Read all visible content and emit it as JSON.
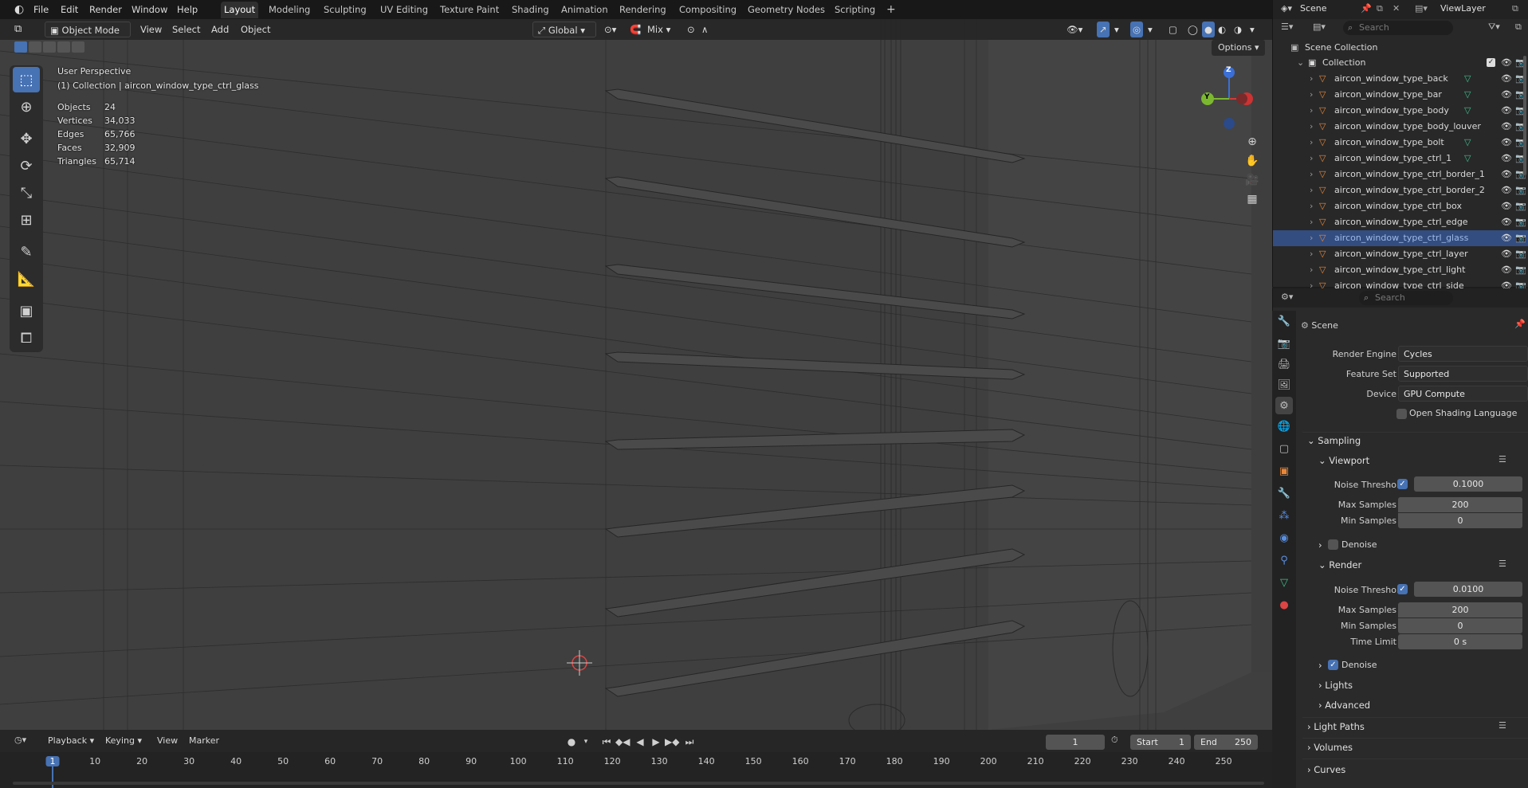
{
  "topbar": {
    "menus": [
      "File",
      "Edit",
      "Render",
      "Window",
      "Help"
    ],
    "workspaces": [
      "Layout",
      "Modeling",
      "Sculpting",
      "UV Editing",
      "Texture Paint",
      "Shading",
      "Animation",
      "Rendering",
      "Compositing",
      "Geometry Nodes",
      "Scripting"
    ],
    "active_workspace": "Layout",
    "scene": "Scene",
    "view_layer": "ViewLayer"
  },
  "viewport_header": {
    "mode": "Object Mode",
    "menus": [
      "View",
      "Select",
      "Add",
      "Object"
    ],
    "orientation": "Global",
    "snap_mode": "Mix",
    "options_label": "Options"
  },
  "overlay": {
    "perspective": "User Perspective",
    "collection_info": "(1) Collection | aircon_window_type_ctrl_glass",
    "stats": [
      {
        "label": "Objects",
        "value": "24"
      },
      {
        "label": "Vertices",
        "value": "34,033"
      },
      {
        "label": "Edges",
        "value": "65,766"
      },
      {
        "label": "Faces",
        "value": "32,909"
      },
      {
        "label": "Triangles",
        "value": "65,714"
      }
    ]
  },
  "gizmo": {
    "y": "Y",
    "z": "Z"
  },
  "outliner": {
    "search_placeholder": "Search",
    "scene_collection": "Scene Collection",
    "collection": "Collection",
    "items": [
      "aircon_window_type_back",
      "aircon_window_type_bar",
      "aircon_window_type_body",
      "aircon_window_type_body_louver",
      "aircon_window_type_bolt",
      "aircon_window_type_ctrl_1",
      "aircon_window_type_ctrl_border_1",
      "aircon_window_type_ctrl_border_2",
      "aircon_window_type_ctrl_box",
      "aircon_window_type_ctrl_edge",
      "aircon_window_type_ctrl_glass",
      "aircon_window_type_ctrl_layer",
      "aircon_window_type_ctrl_light",
      "aircon_window_type_ctrl_side"
    ],
    "selected": "aircon_window_type_ctrl_glass"
  },
  "properties": {
    "search_placeholder": "Search",
    "context": "Scene",
    "render_engine_label": "Render Engine",
    "render_engine": "Cycles",
    "feature_set_label": "Feature Set",
    "feature_set": "Supported",
    "device_label": "Device",
    "device": "GPU Compute",
    "osl_label": "Open Shading Language",
    "sampling": "Sampling",
    "viewport": "Viewport",
    "noise_threshold_label": "Noise Threshold",
    "viewport_noise_threshold": "0.1000",
    "max_samples_label": "Max Samples",
    "viewport_max_samples": "200",
    "min_samples_label": "Min Samples",
    "viewport_min_samples": "0",
    "denoise_label": "Denoise",
    "render": "Render",
    "render_noise_threshold": "0.0100",
    "render_max_samples": "200",
    "render_min_samples": "0",
    "time_limit_label": "Time Limit",
    "time_limit": "0 s",
    "lights": "Lights",
    "advanced": "Advanced",
    "light_paths": "Light Paths",
    "volumes": "Volumes",
    "curves": "Curves"
  },
  "timeline": {
    "menus": [
      "Playback",
      "Keying",
      "View",
      "Marker"
    ],
    "current_frame": "1",
    "start_label": "Start",
    "start": "1",
    "end_label": "End",
    "end": "250",
    "ruler": [
      "1",
      "10",
      "20",
      "30",
      "40",
      "50",
      "60",
      "70",
      "80",
      "90",
      "100",
      "110",
      "120",
      "130",
      "140",
      "150",
      "160",
      "170",
      "180",
      "190",
      "200",
      "210",
      "220",
      "230",
      "240",
      "250"
    ]
  },
  "colors": {
    "accent": "#4772b3",
    "mesh_icon": "#e8883a",
    "vertex_icon": "#3fbf8f"
  }
}
